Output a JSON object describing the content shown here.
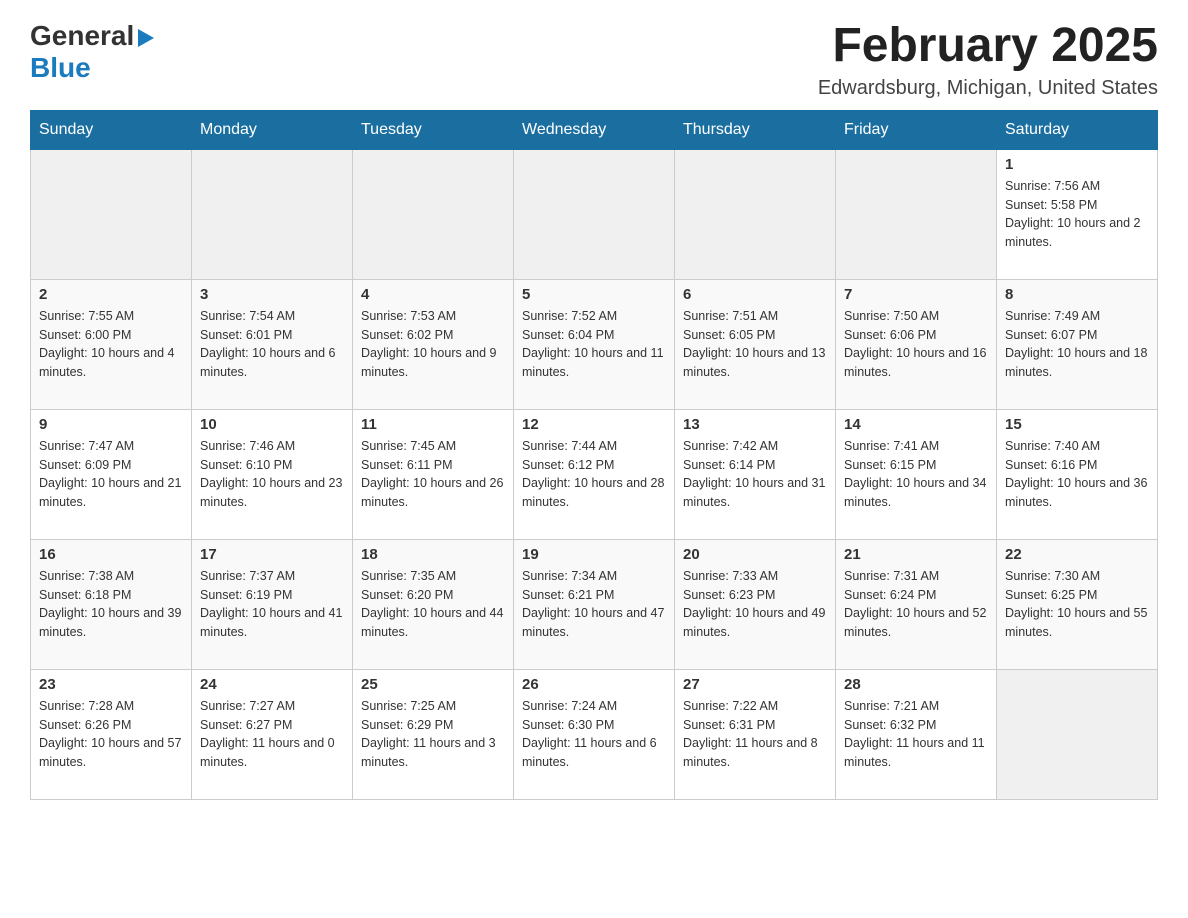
{
  "header": {
    "logo_general": "General",
    "logo_blue": "Blue",
    "title": "February 2025",
    "location": "Edwardsburg, Michigan, United States"
  },
  "weekdays": [
    "Sunday",
    "Monday",
    "Tuesday",
    "Wednesday",
    "Thursday",
    "Friday",
    "Saturday"
  ],
  "weeks": [
    [
      {
        "day": "",
        "info": ""
      },
      {
        "day": "",
        "info": ""
      },
      {
        "day": "",
        "info": ""
      },
      {
        "day": "",
        "info": ""
      },
      {
        "day": "",
        "info": ""
      },
      {
        "day": "",
        "info": ""
      },
      {
        "day": "1",
        "info": "Sunrise: 7:56 AM\nSunset: 5:58 PM\nDaylight: 10 hours and 2 minutes."
      }
    ],
    [
      {
        "day": "2",
        "info": "Sunrise: 7:55 AM\nSunset: 6:00 PM\nDaylight: 10 hours and 4 minutes."
      },
      {
        "day": "3",
        "info": "Sunrise: 7:54 AM\nSunset: 6:01 PM\nDaylight: 10 hours and 6 minutes."
      },
      {
        "day": "4",
        "info": "Sunrise: 7:53 AM\nSunset: 6:02 PM\nDaylight: 10 hours and 9 minutes."
      },
      {
        "day": "5",
        "info": "Sunrise: 7:52 AM\nSunset: 6:04 PM\nDaylight: 10 hours and 11 minutes."
      },
      {
        "day": "6",
        "info": "Sunrise: 7:51 AM\nSunset: 6:05 PM\nDaylight: 10 hours and 13 minutes."
      },
      {
        "day": "7",
        "info": "Sunrise: 7:50 AM\nSunset: 6:06 PM\nDaylight: 10 hours and 16 minutes."
      },
      {
        "day": "8",
        "info": "Sunrise: 7:49 AM\nSunset: 6:07 PM\nDaylight: 10 hours and 18 minutes."
      }
    ],
    [
      {
        "day": "9",
        "info": "Sunrise: 7:47 AM\nSunset: 6:09 PM\nDaylight: 10 hours and 21 minutes."
      },
      {
        "day": "10",
        "info": "Sunrise: 7:46 AM\nSunset: 6:10 PM\nDaylight: 10 hours and 23 minutes."
      },
      {
        "day": "11",
        "info": "Sunrise: 7:45 AM\nSunset: 6:11 PM\nDaylight: 10 hours and 26 minutes."
      },
      {
        "day": "12",
        "info": "Sunrise: 7:44 AM\nSunset: 6:12 PM\nDaylight: 10 hours and 28 minutes."
      },
      {
        "day": "13",
        "info": "Sunrise: 7:42 AM\nSunset: 6:14 PM\nDaylight: 10 hours and 31 minutes."
      },
      {
        "day": "14",
        "info": "Sunrise: 7:41 AM\nSunset: 6:15 PM\nDaylight: 10 hours and 34 minutes."
      },
      {
        "day": "15",
        "info": "Sunrise: 7:40 AM\nSunset: 6:16 PM\nDaylight: 10 hours and 36 minutes."
      }
    ],
    [
      {
        "day": "16",
        "info": "Sunrise: 7:38 AM\nSunset: 6:18 PM\nDaylight: 10 hours and 39 minutes."
      },
      {
        "day": "17",
        "info": "Sunrise: 7:37 AM\nSunset: 6:19 PM\nDaylight: 10 hours and 41 minutes."
      },
      {
        "day": "18",
        "info": "Sunrise: 7:35 AM\nSunset: 6:20 PM\nDaylight: 10 hours and 44 minutes."
      },
      {
        "day": "19",
        "info": "Sunrise: 7:34 AM\nSunset: 6:21 PM\nDaylight: 10 hours and 47 minutes."
      },
      {
        "day": "20",
        "info": "Sunrise: 7:33 AM\nSunset: 6:23 PM\nDaylight: 10 hours and 49 minutes."
      },
      {
        "day": "21",
        "info": "Sunrise: 7:31 AM\nSunset: 6:24 PM\nDaylight: 10 hours and 52 minutes."
      },
      {
        "day": "22",
        "info": "Sunrise: 7:30 AM\nSunset: 6:25 PM\nDaylight: 10 hours and 55 minutes."
      }
    ],
    [
      {
        "day": "23",
        "info": "Sunrise: 7:28 AM\nSunset: 6:26 PM\nDaylight: 10 hours and 57 minutes."
      },
      {
        "day": "24",
        "info": "Sunrise: 7:27 AM\nSunset: 6:27 PM\nDaylight: 11 hours and 0 minutes."
      },
      {
        "day": "25",
        "info": "Sunrise: 7:25 AM\nSunset: 6:29 PM\nDaylight: 11 hours and 3 minutes."
      },
      {
        "day": "26",
        "info": "Sunrise: 7:24 AM\nSunset: 6:30 PM\nDaylight: 11 hours and 6 minutes."
      },
      {
        "day": "27",
        "info": "Sunrise: 7:22 AM\nSunset: 6:31 PM\nDaylight: 11 hours and 8 minutes."
      },
      {
        "day": "28",
        "info": "Sunrise: 7:21 AM\nSunset: 6:32 PM\nDaylight: 11 hours and 11 minutes."
      },
      {
        "day": "",
        "info": ""
      }
    ]
  ]
}
